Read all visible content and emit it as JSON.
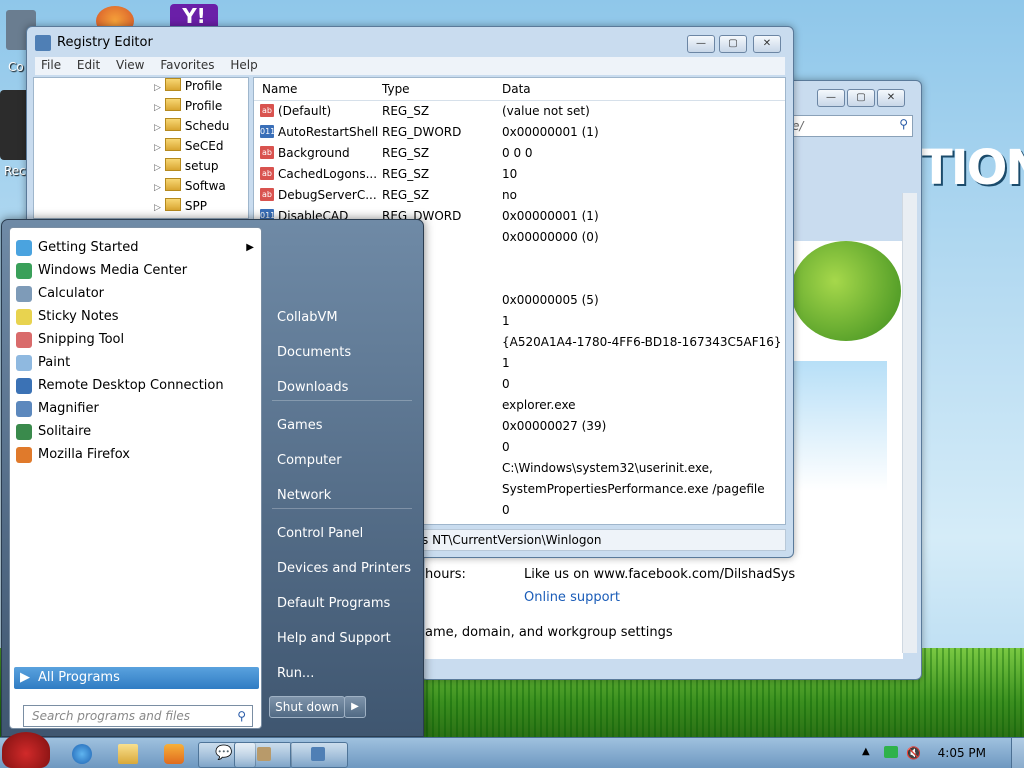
{
  "desktop": {
    "label_left_top": "Co",
    "label_left_mid": "Rec"
  },
  "registry": {
    "title": "Registry Editor",
    "menu": [
      "File",
      "Edit",
      "View",
      "Favorites",
      "Help"
    ],
    "tree": [
      "Profile",
      "Profile",
      "Schedu",
      "SeCEd",
      "setup",
      "Softwa",
      "SPP"
    ],
    "columns": {
      "name": "Name",
      "type": "Type",
      "data": "Data"
    },
    "rows": [
      {
        "name": "(Default)",
        "type": "REG_SZ",
        "data": "(value not set)",
        "kind": "sz"
      },
      {
        "name": "AutoRestartShell",
        "type": "REG_DWORD",
        "data": "0x00000001 (1)",
        "kind": "dw"
      },
      {
        "name": "Background",
        "type": "REG_SZ",
        "data": "0 0 0",
        "kind": "sz"
      },
      {
        "name": "CachedLogons...",
        "type": "REG_SZ",
        "data": "10",
        "kind": "sz"
      },
      {
        "name": "DebugServerC...",
        "type": "REG_SZ",
        "data": "no",
        "kind": "sz"
      },
      {
        "name": "DisableCAD",
        "type": "REG_DWORD",
        "data": "0x00000001 (1)",
        "kind": "dw"
      },
      {
        "name": "",
        "type": "WORD",
        "data": "0x00000000 (0)",
        "kind": ""
      },
      {
        "name": "",
        "type": "",
        "data": "",
        "kind": ""
      },
      {
        "name": "",
        "type": "",
        "data": "",
        "kind": ""
      },
      {
        "name": "",
        "type": "WORD",
        "data": "0x00000005 (5)",
        "kind": ""
      },
      {
        "name": "",
        "type": "",
        "data": "1",
        "kind": ""
      },
      {
        "name": "",
        "type": "",
        "data": "{A520A1A4-1780-4FF6-BD18-167343C5AF16}",
        "kind": ""
      },
      {
        "name": "",
        "type": "",
        "data": "1",
        "kind": ""
      },
      {
        "name": "",
        "type": "",
        "data": "0",
        "kind": ""
      },
      {
        "name": "",
        "type": "",
        "data": "explorer.exe",
        "kind": ""
      },
      {
        "name": "",
        "type": "WORD",
        "data": "0x00000027 (39)",
        "kind": ""
      },
      {
        "name": "",
        "type": "",
        "data": "0",
        "kind": ""
      },
      {
        "name": "",
        "type": "",
        "data": "C:\\Windows\\system32\\userinit.exe,",
        "kind": ""
      },
      {
        "name": "",
        "type": "",
        "data": "SystemPropertiesPerformance.exe /pagefile",
        "kind": ""
      },
      {
        "name": "",
        "type": "",
        "data": "0",
        "kind": ""
      }
    ],
    "status": "s NT\\CurrentVersion\\Winlogon"
  },
  "background_window": {
    "search_placeholder": "e/",
    "hours_label": "hours:",
    "facebook_text": "Like us on www.facebook.com/DilshadSys",
    "online_support": "Online support",
    "settings_text": "ame, domain, and workgroup settings",
    "banner_text": "TION"
  },
  "start_menu": {
    "programs": [
      {
        "label": "Getting Started",
        "has_arrow": true,
        "color": "#4aa3df"
      },
      {
        "label": "Windows Media Center",
        "color": "#3aa05a"
      },
      {
        "label": "Calculator",
        "color": "#7e9bb8"
      },
      {
        "label": "Sticky Notes",
        "color": "#e8d34f"
      },
      {
        "label": "Snipping Tool",
        "color": "#d96b6b"
      },
      {
        "label": "Paint",
        "color": "#8fb9e0"
      },
      {
        "label": "Remote Desktop Connection",
        "color": "#3b72b5"
      },
      {
        "label": "Magnifier",
        "color": "#5c88bd"
      },
      {
        "label": "Solitaire",
        "color": "#3a8a4c"
      },
      {
        "label": "Mozilla Firefox",
        "color": "#e07a2b"
      }
    ],
    "all_programs": "All Programs",
    "search_placeholder": "Search programs and files",
    "right_items": [
      "CollabVM",
      "Documents",
      "Downloads",
      "Games",
      "Computer",
      "Network",
      "Control Panel",
      "Devices and Printers",
      "Default Programs",
      "Help and Support",
      "Run..."
    ],
    "shutdown": "Shut down"
  },
  "taskbar": {
    "clock": "4:05 PM"
  }
}
